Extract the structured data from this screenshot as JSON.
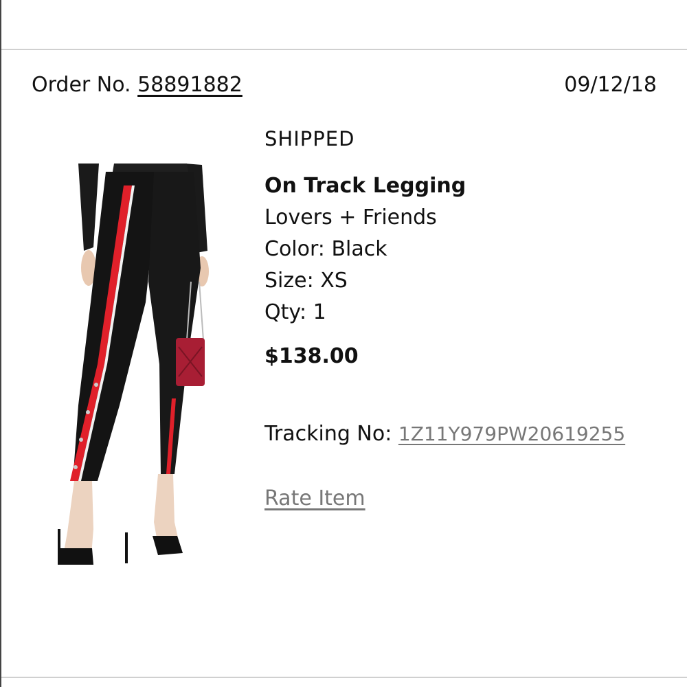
{
  "order": {
    "label": "Order No.",
    "number": "58891882",
    "date": "09/12/18"
  },
  "item": {
    "status": "SHIPPED",
    "name": "On Track Legging",
    "brand": "Lovers + Friends",
    "color": "Color: Black",
    "size": "Size: XS",
    "qty": "Qty: 1",
    "price": "$138.00",
    "tracking_label": "Tracking No:",
    "tracking_number": "1Z11Y979PW20619255",
    "rate_label": "Rate Item"
  },
  "image": {
    "description_icon": "product-photo-legging",
    "stripe_color": "#e0202a",
    "garment_color": "#141414"
  }
}
